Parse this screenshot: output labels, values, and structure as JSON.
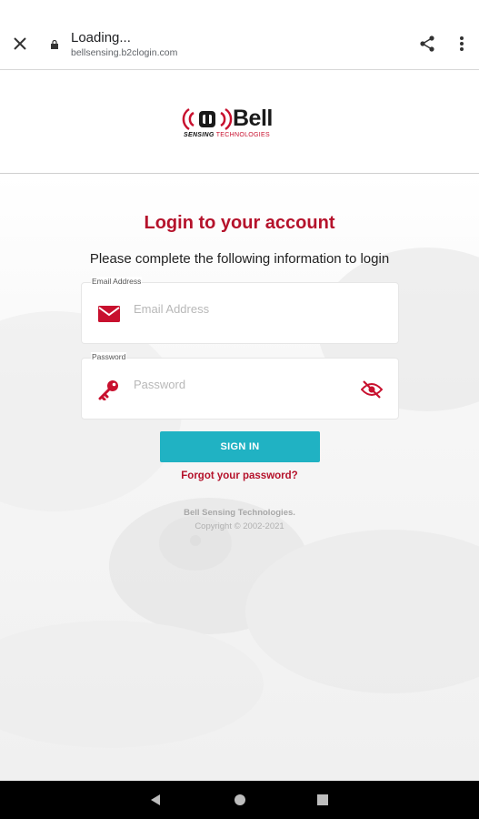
{
  "browser": {
    "title": "Loading...",
    "url": "bellsensing.b2clogin.com",
    "icons": {
      "close": "close-icon",
      "lock": "lock-icon",
      "share": "share-icon",
      "more": "more-vert-icon"
    }
  },
  "brand": {
    "logo_text": "Bell",
    "logo_sub_bold": "SENSING",
    "logo_sub_light": "TECHNOLOGIES",
    "colors": {
      "primary": "#b5122b",
      "accent": "#20b2c3"
    }
  },
  "login": {
    "heading": "Login to your account",
    "subheading": "Please complete the following information to login",
    "email": {
      "label": "Email Address",
      "placeholder": "Email Address",
      "value": "",
      "icon": "mail-icon"
    },
    "password": {
      "label": "Password",
      "placeholder": "Password",
      "value": "",
      "icon": "key-icon",
      "toggle_icon": "eye-off-icon"
    },
    "signin_label": "SIGN IN",
    "forgot_label": "Forgot your password?"
  },
  "footer": {
    "company": "Bell Sensing Technologies.",
    "copyright": "Copyright © 2002-2021"
  },
  "navbar": {
    "icons": [
      "back-icon",
      "home-icon",
      "recents-icon"
    ]
  }
}
